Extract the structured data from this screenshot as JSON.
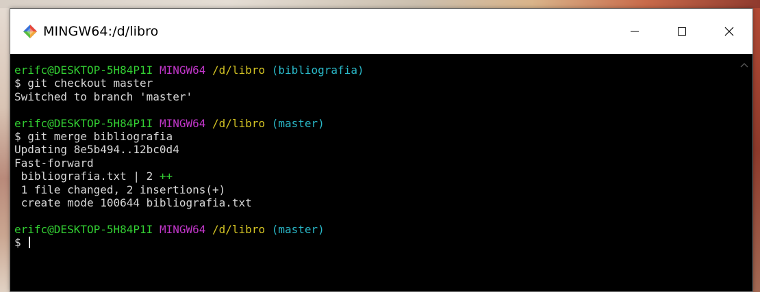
{
  "window": {
    "title": "MINGW64:/d/libro",
    "icon": "git-bash-icon",
    "controls": {
      "minimize_icon": "minimize-icon",
      "maximize_icon": "maximize-icon",
      "close_icon": "close-icon"
    }
  },
  "colors": {
    "user": "#33d033",
    "host": "#c036c8",
    "path": "#d4c424",
    "branch": "#2ab9c9",
    "text": "#d7d7d7",
    "background": "#000000"
  },
  "terminal": {
    "prompt1": {
      "user": "erifc@DESKTOP-5H84P1I",
      "host": "MINGW64",
      "path": "/d/libro",
      "branch": "(bibliografia)"
    },
    "cmd1": "$ git checkout master",
    "out1": "Switched to branch 'master'",
    "prompt2": {
      "user": "erifc@DESKTOP-5H84P1I",
      "host": "MINGW64",
      "path": "/d/libro",
      "branch": "(master)"
    },
    "cmd2": "$ git merge bibliografia",
    "out2": [
      "Updating 8e5b494..12bc0d4",
      "Fast-forward"
    ],
    "diffstat": {
      "file": " bibliografia.txt | 2 ",
      "plus": "++"
    },
    "out3": [
      " 1 file changed, 2 insertions(+)",
      " create mode 100644 bibliografia.txt"
    ],
    "prompt3": {
      "user": "erifc@DESKTOP-5H84P1I",
      "host": "MINGW64",
      "path": "/d/libro",
      "branch": "(master)"
    },
    "current_input": "$ "
  }
}
